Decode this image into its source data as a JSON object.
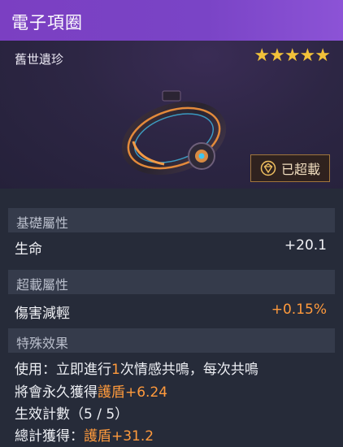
{
  "item": {
    "name": "電子項圈",
    "rarity": "舊世遺珍",
    "stars": "★★★★★"
  },
  "overload_badge": {
    "label": "已超載",
    "icon": "overload-gem-icon"
  },
  "colors": {
    "title_bar": "#7b3fc2",
    "stars": "#f2c23a",
    "highlight": "#ff9a3c",
    "section_bg": "#353b4b"
  },
  "sections": {
    "base": {
      "title": "基礎屬性",
      "stat_label": "生命",
      "stat_value": "+20.1"
    },
    "overload": {
      "title": "超載屬性",
      "stat_label": "傷害減輕",
      "stat_value": "+0.15%"
    },
    "special": {
      "title": "特殊效果",
      "line1_a": "使用：立即進行",
      "line1_num": "1",
      "line1_b": "次情感共鳴，每次共鳴",
      "line2_a": "將會永久獲得",
      "line2_hl": "護盾+6.24",
      "line3": "生效計數（5 / 5）",
      "line4_a": "總計獲得：",
      "line4_hl": "護盾+31.2"
    }
  }
}
